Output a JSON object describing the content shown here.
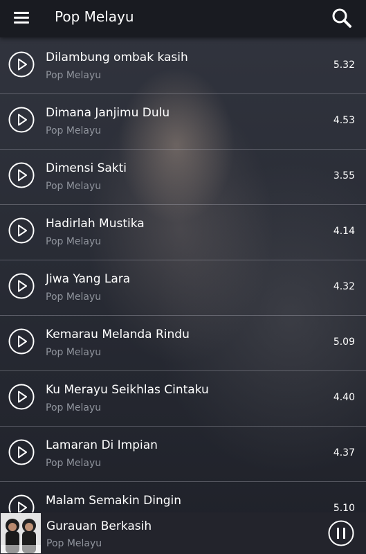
{
  "appbar": {
    "title": "Pop Melayu",
    "menu_icon": "hamburger-menu-icon",
    "search_icon": "search-icon"
  },
  "songs": [
    {
      "title": "Dilambung ombak kasih",
      "artist": "Pop Melayu",
      "duration": "5.32"
    },
    {
      "title": "Dimana Janjimu Dulu",
      "artist": "Pop Melayu",
      "duration": "4.53"
    },
    {
      "title": "Dimensi Sakti",
      "artist": "Pop Melayu",
      "duration": "3.55"
    },
    {
      "title": "Hadirlah Mustika",
      "artist": "Pop Melayu",
      "duration": "4.14"
    },
    {
      "title": "Jiwa Yang Lara",
      "artist": "Pop Melayu",
      "duration": "4.32"
    },
    {
      "title": "Kemarau Melanda Rindu",
      "artist": "Pop Melayu",
      "duration": "5.09"
    },
    {
      "title": "Ku Merayu Seikhlas Cintaku",
      "artist": "Pop Melayu",
      "duration": "4.40"
    },
    {
      "title": "Lamaran Di Impian",
      "artist": "Pop Melayu",
      "duration": "4.37"
    },
    {
      "title": "Malam Semakin Dingin",
      "artist": "Pop Melayu",
      "duration": "5.10"
    }
  ],
  "now_playing": {
    "title": "Gurauan Berkasih",
    "artist": "Pop Melayu",
    "pause_icon": "pause-icon"
  },
  "colors": {
    "text": "#ffffff",
    "secondary_text": "#8f939c",
    "divider": "#a9abb5"
  }
}
